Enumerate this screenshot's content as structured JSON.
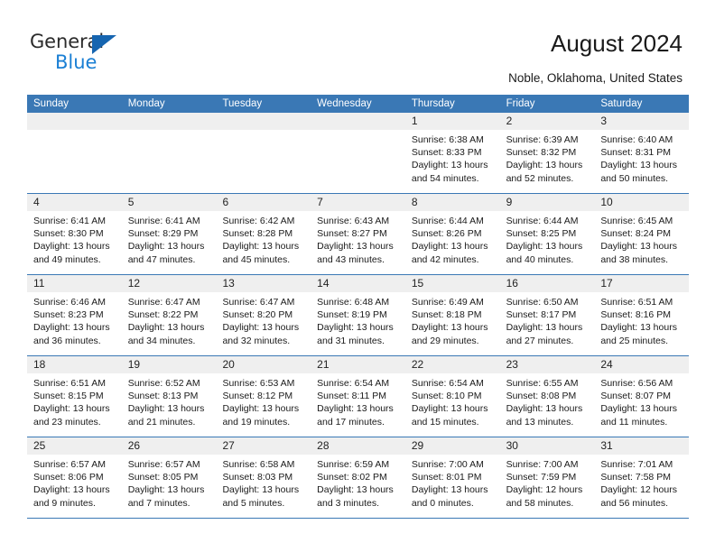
{
  "brand": {
    "name_top": "General",
    "name_bottom": "Blue",
    "triangle_color": "#1665b0",
    "blue_text_color": "#1a7fd4"
  },
  "header": {
    "title": "August 2024",
    "subtitle": "Noble, Oklahoma, United States"
  },
  "theme": {
    "header_blue": "#3a78b5",
    "day_band_gray": "#efefef",
    "text": "#1a1a1a"
  },
  "weekdays": [
    "Sunday",
    "Monday",
    "Tuesday",
    "Wednesday",
    "Thursday",
    "Friday",
    "Saturday"
  ],
  "weeks": [
    [
      {
        "day": "",
        "sunrise": "",
        "sunset": "",
        "daylight_line1": "",
        "daylight_line2": "",
        "empty": true
      },
      {
        "day": "",
        "sunrise": "",
        "sunset": "",
        "daylight_line1": "",
        "daylight_line2": "",
        "empty": true
      },
      {
        "day": "",
        "sunrise": "",
        "sunset": "",
        "daylight_line1": "",
        "daylight_line2": "",
        "empty": true
      },
      {
        "day": "",
        "sunrise": "",
        "sunset": "",
        "daylight_line1": "",
        "daylight_line2": "",
        "empty": true
      },
      {
        "day": "1",
        "sunrise": "Sunrise: 6:38 AM",
        "sunset": "Sunset: 8:33 PM",
        "daylight_line1": "Daylight: 13 hours",
        "daylight_line2": "and 54 minutes."
      },
      {
        "day": "2",
        "sunrise": "Sunrise: 6:39 AM",
        "sunset": "Sunset: 8:32 PM",
        "daylight_line1": "Daylight: 13 hours",
        "daylight_line2": "and 52 minutes."
      },
      {
        "day": "3",
        "sunrise": "Sunrise: 6:40 AM",
        "sunset": "Sunset: 8:31 PM",
        "daylight_line1": "Daylight: 13 hours",
        "daylight_line2": "and 50 minutes."
      }
    ],
    [
      {
        "day": "4",
        "sunrise": "Sunrise: 6:41 AM",
        "sunset": "Sunset: 8:30 PM",
        "daylight_line1": "Daylight: 13 hours",
        "daylight_line2": "and 49 minutes."
      },
      {
        "day": "5",
        "sunrise": "Sunrise: 6:41 AM",
        "sunset": "Sunset: 8:29 PM",
        "daylight_line1": "Daylight: 13 hours",
        "daylight_line2": "and 47 minutes."
      },
      {
        "day": "6",
        "sunrise": "Sunrise: 6:42 AM",
        "sunset": "Sunset: 8:28 PM",
        "daylight_line1": "Daylight: 13 hours",
        "daylight_line2": "and 45 minutes."
      },
      {
        "day": "7",
        "sunrise": "Sunrise: 6:43 AM",
        "sunset": "Sunset: 8:27 PM",
        "daylight_line1": "Daylight: 13 hours",
        "daylight_line2": "and 43 minutes."
      },
      {
        "day": "8",
        "sunrise": "Sunrise: 6:44 AM",
        "sunset": "Sunset: 8:26 PM",
        "daylight_line1": "Daylight: 13 hours",
        "daylight_line2": "and 42 minutes."
      },
      {
        "day": "9",
        "sunrise": "Sunrise: 6:44 AM",
        "sunset": "Sunset: 8:25 PM",
        "daylight_line1": "Daylight: 13 hours",
        "daylight_line2": "and 40 minutes."
      },
      {
        "day": "10",
        "sunrise": "Sunrise: 6:45 AM",
        "sunset": "Sunset: 8:24 PM",
        "daylight_line1": "Daylight: 13 hours",
        "daylight_line2": "and 38 minutes."
      }
    ],
    [
      {
        "day": "11",
        "sunrise": "Sunrise: 6:46 AM",
        "sunset": "Sunset: 8:23 PM",
        "daylight_line1": "Daylight: 13 hours",
        "daylight_line2": "and 36 minutes."
      },
      {
        "day": "12",
        "sunrise": "Sunrise: 6:47 AM",
        "sunset": "Sunset: 8:22 PM",
        "daylight_line1": "Daylight: 13 hours",
        "daylight_line2": "and 34 minutes."
      },
      {
        "day": "13",
        "sunrise": "Sunrise: 6:47 AM",
        "sunset": "Sunset: 8:20 PM",
        "daylight_line1": "Daylight: 13 hours",
        "daylight_line2": "and 32 minutes."
      },
      {
        "day": "14",
        "sunrise": "Sunrise: 6:48 AM",
        "sunset": "Sunset: 8:19 PM",
        "daylight_line1": "Daylight: 13 hours",
        "daylight_line2": "and 31 minutes."
      },
      {
        "day": "15",
        "sunrise": "Sunrise: 6:49 AM",
        "sunset": "Sunset: 8:18 PM",
        "daylight_line1": "Daylight: 13 hours",
        "daylight_line2": "and 29 minutes."
      },
      {
        "day": "16",
        "sunrise": "Sunrise: 6:50 AM",
        "sunset": "Sunset: 8:17 PM",
        "daylight_line1": "Daylight: 13 hours",
        "daylight_line2": "and 27 minutes."
      },
      {
        "day": "17",
        "sunrise": "Sunrise: 6:51 AM",
        "sunset": "Sunset: 8:16 PM",
        "daylight_line1": "Daylight: 13 hours",
        "daylight_line2": "and 25 minutes."
      }
    ],
    [
      {
        "day": "18",
        "sunrise": "Sunrise: 6:51 AM",
        "sunset": "Sunset: 8:15 PM",
        "daylight_line1": "Daylight: 13 hours",
        "daylight_line2": "and 23 minutes."
      },
      {
        "day": "19",
        "sunrise": "Sunrise: 6:52 AM",
        "sunset": "Sunset: 8:13 PM",
        "daylight_line1": "Daylight: 13 hours",
        "daylight_line2": "and 21 minutes."
      },
      {
        "day": "20",
        "sunrise": "Sunrise: 6:53 AM",
        "sunset": "Sunset: 8:12 PM",
        "daylight_line1": "Daylight: 13 hours",
        "daylight_line2": "and 19 minutes."
      },
      {
        "day": "21",
        "sunrise": "Sunrise: 6:54 AM",
        "sunset": "Sunset: 8:11 PM",
        "daylight_line1": "Daylight: 13 hours",
        "daylight_line2": "and 17 minutes."
      },
      {
        "day": "22",
        "sunrise": "Sunrise: 6:54 AM",
        "sunset": "Sunset: 8:10 PM",
        "daylight_line1": "Daylight: 13 hours",
        "daylight_line2": "and 15 minutes."
      },
      {
        "day": "23",
        "sunrise": "Sunrise: 6:55 AM",
        "sunset": "Sunset: 8:08 PM",
        "daylight_line1": "Daylight: 13 hours",
        "daylight_line2": "and 13 minutes."
      },
      {
        "day": "24",
        "sunrise": "Sunrise: 6:56 AM",
        "sunset": "Sunset: 8:07 PM",
        "daylight_line1": "Daylight: 13 hours",
        "daylight_line2": "and 11 minutes."
      }
    ],
    [
      {
        "day": "25",
        "sunrise": "Sunrise: 6:57 AM",
        "sunset": "Sunset: 8:06 PM",
        "daylight_line1": "Daylight: 13 hours",
        "daylight_line2": "and 9 minutes."
      },
      {
        "day": "26",
        "sunrise": "Sunrise: 6:57 AM",
        "sunset": "Sunset: 8:05 PM",
        "daylight_line1": "Daylight: 13 hours",
        "daylight_line2": "and 7 minutes."
      },
      {
        "day": "27",
        "sunrise": "Sunrise: 6:58 AM",
        "sunset": "Sunset: 8:03 PM",
        "daylight_line1": "Daylight: 13 hours",
        "daylight_line2": "and 5 minutes."
      },
      {
        "day": "28",
        "sunrise": "Sunrise: 6:59 AM",
        "sunset": "Sunset: 8:02 PM",
        "daylight_line1": "Daylight: 13 hours",
        "daylight_line2": "and 3 minutes."
      },
      {
        "day": "29",
        "sunrise": "Sunrise: 7:00 AM",
        "sunset": "Sunset: 8:01 PM",
        "daylight_line1": "Daylight: 13 hours",
        "daylight_line2": "and 0 minutes."
      },
      {
        "day": "30",
        "sunrise": "Sunrise: 7:00 AM",
        "sunset": "Sunset: 7:59 PM",
        "daylight_line1": "Daylight: 12 hours",
        "daylight_line2": "and 58 minutes."
      },
      {
        "day": "31",
        "sunrise": "Sunrise: 7:01 AM",
        "sunset": "Sunset: 7:58 PM",
        "daylight_line1": "Daylight: 12 hours",
        "daylight_line2": "and 56 minutes."
      }
    ]
  ]
}
